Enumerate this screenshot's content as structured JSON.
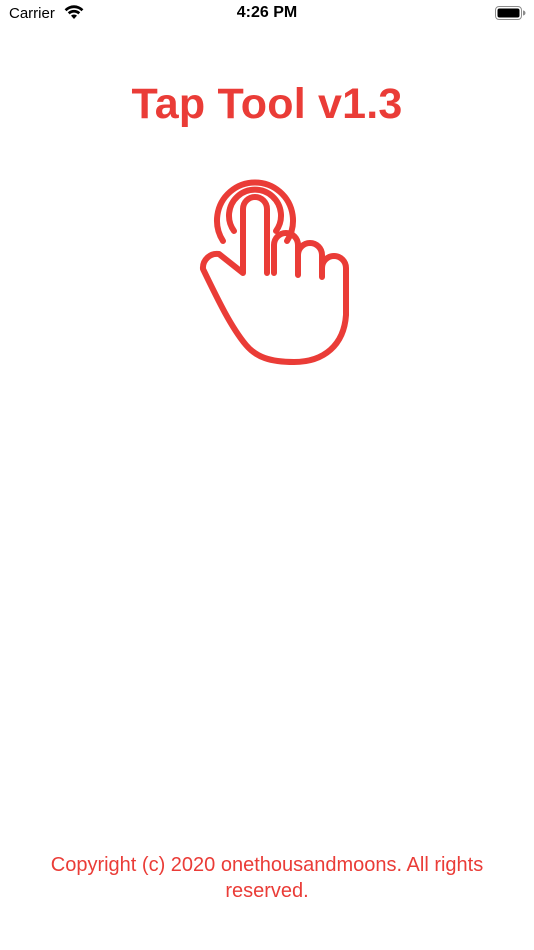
{
  "status_bar": {
    "carrier": "Carrier",
    "time": "4:26 PM",
    "wifi_icon": "wifi-icon",
    "battery_icon": "battery-icon",
    "battery_level": 0.9
  },
  "app": {
    "title": "Tap Tool v1.3",
    "logo_icon": "tap-hand-icon",
    "copyright": "Copyright (c) 2020 onethousandmoons. All rights reserved.",
    "accent_color": "#ea3c37"
  }
}
